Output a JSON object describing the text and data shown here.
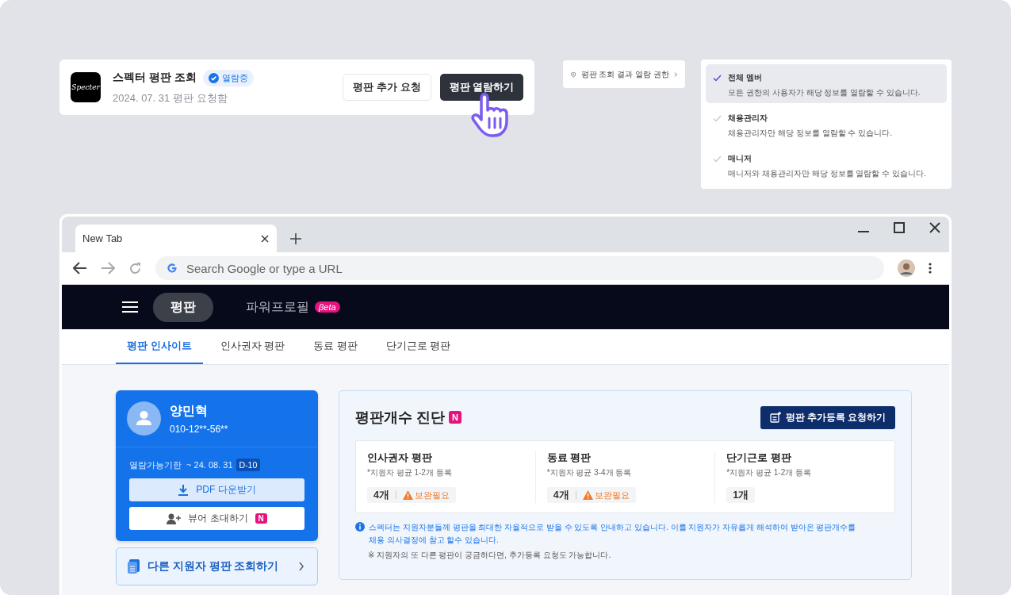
{
  "request_card": {
    "logo_text": "Specter",
    "title": "스펙터 평판 조회",
    "badge": "열람중",
    "subtitle": "2024. 07. 31 평판 요청함",
    "buttons": [
      {
        "label": "평판 추가 요청",
        "kind": "secondary"
      },
      {
        "label": "평판 열람하기",
        "kind": "primary"
      }
    ]
  },
  "permission_button": {
    "label": "평판 조회 결과 열람 권한"
  },
  "permission_options": [
    {
      "title": "전체 멤버",
      "description": "모든 권한의 사용자가 해당 정보를 열람할 수 있습니다.",
      "selected": true
    },
    {
      "title": "채용관리자",
      "description": "채용관리자만 해당 정보를 열람할 수 있습니다.",
      "selected": false
    },
    {
      "title": "매니저",
      "description": "매니저와 채용관리자만 해당 정보를 열람할 수 있습니다.",
      "selected": false
    }
  ],
  "browser": {
    "tab_title": "New Tab",
    "address_placeholder": "Search Google or type a URL"
  },
  "site_nav": [
    {
      "label": "평판",
      "selected": true
    },
    {
      "label": "파워프로필",
      "selected": false,
      "badge": "βeta"
    }
  ],
  "sub_tabs": [
    {
      "label": "평판 인사이트",
      "selected": true
    },
    {
      "label": "인사권자 평판",
      "selected": false
    },
    {
      "label": "동료 평판",
      "selected": false
    },
    {
      "label": "단기근로 평판",
      "selected": false
    }
  ],
  "profile": {
    "name": "양민혁",
    "phone": "010-12**-56**",
    "deadline_label": "열람가능기한  ~ 24. 08. 31",
    "d_day": "D-10",
    "buttons": [
      {
        "label": "PDF 다운받기",
        "kind": "download"
      },
      {
        "label": "뷰어 초대하기",
        "kind": "invite",
        "badge": "N"
      }
    ]
  },
  "other_lookup": {
    "label": "다른 지원자 평판 조회하기"
  },
  "diagnosis": {
    "title": "평판개수 진단",
    "badge": "N",
    "request_button": "평판 추가등록 요청하기",
    "categories": [
      {
        "title": "인사권자 평판",
        "hint": "*지원자 평균 1-2개 등록",
        "count": "4개",
        "warning": "보완필요"
      },
      {
        "title": "동료 평판",
        "hint": "*지원자 평균 3-4개 등록",
        "count": "4개",
        "warning": "보완필요"
      },
      {
        "title": "단기근로 평판",
        "hint": "*지원자 평균 1-2개 등록",
        "count": "1개"
      }
    ],
    "info": "스펙터는 지원자분들께 평판을 최대한 자율적으로 받을 수 있도록 안내하고 있습니다. 이를 지원자가 자유롭게 해석하여 받아온 평판개수를 채용 의사결정에 참고 할수 있습니다.",
    "note": "※ 지원자의 또 다른 평판이 궁금하다면, 추가등록 요청도 가능합니다."
  }
}
